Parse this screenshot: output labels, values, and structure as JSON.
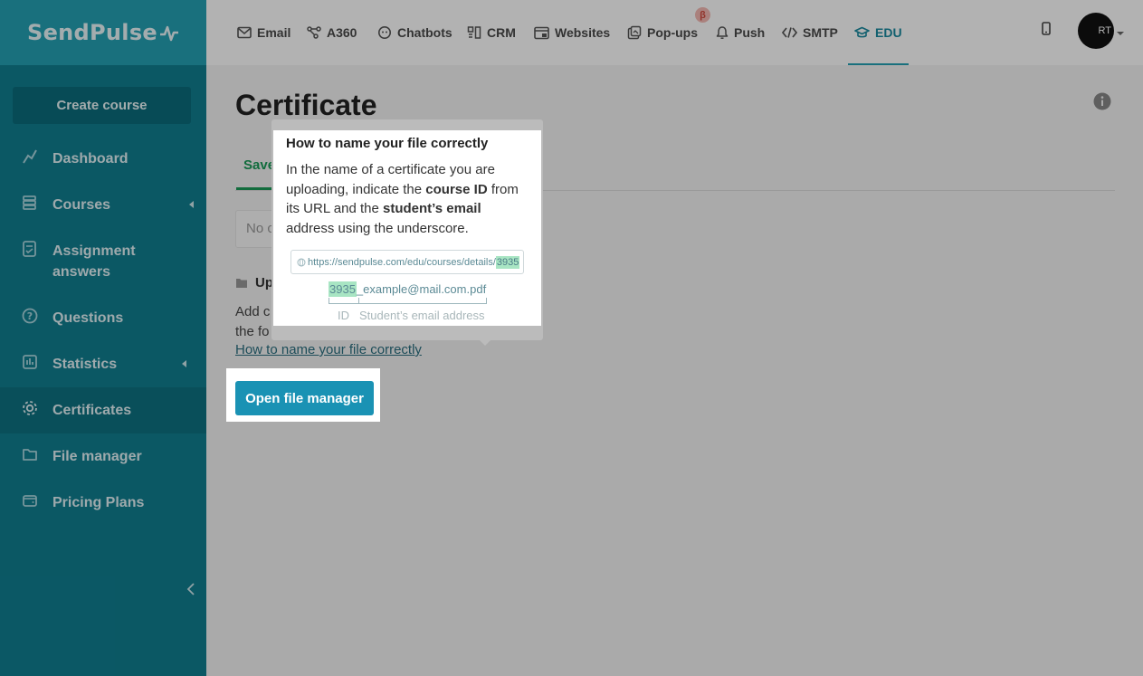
{
  "brand": {
    "logo_text": "SendPulse"
  },
  "sidebar": {
    "create_label": "Create course",
    "items": [
      {
        "label": "Dashboard",
        "icon": "chart-line-icon"
      },
      {
        "label": "Courses",
        "icon": "stack-icon",
        "has_submenu": true
      },
      {
        "label": "Assignment answers",
        "icon": "checklist-icon"
      },
      {
        "label": "Questions",
        "icon": "question-circle-icon"
      },
      {
        "label": "Statistics",
        "icon": "stats-icon",
        "has_submenu": true
      },
      {
        "label": "Certificates",
        "icon": "gear-badge-icon",
        "active": true
      },
      {
        "label": "File manager",
        "icon": "folder-icon"
      },
      {
        "label": "Pricing Plans",
        "icon": "wallet-icon"
      }
    ]
  },
  "topnav": {
    "items": [
      {
        "label": "Email",
        "icon": "envelope-icon"
      },
      {
        "label": "A360",
        "icon": "flow-icon"
      },
      {
        "label": "Chatbots",
        "icon": "chat-bubble-icon"
      },
      {
        "label": "CRM",
        "icon": "crm-icon"
      },
      {
        "label": "Websites",
        "icon": "website-icon"
      },
      {
        "label": "Pop-ups",
        "icon": "popup-icon"
      },
      {
        "label": "Push",
        "icon": "bell-icon"
      },
      {
        "label": "SMTP",
        "icon": "code-icon"
      },
      {
        "label": "EDU",
        "icon": "graduation-cap-icon",
        "active": true
      }
    ],
    "beta_badge": "β",
    "avatar_text": "RT"
  },
  "main": {
    "title": "Certificate",
    "tab_saved": "Save",
    "empty_text": "No c",
    "upload_title": "Up",
    "upload_text_1": "Add c",
    "upload_text_2": "the fo",
    "howto_link": "How to name your file correctly",
    "open_file_manager": "Open file manager"
  },
  "popover": {
    "title": "How to name your file correctly",
    "body_1": "In the name of a certificate you are uploading, indicate the ",
    "body_bold_1": "course ID",
    "body_2": " from its URL and the ",
    "body_bold_2": "student’s email",
    "body_3": " address using the underscore.",
    "url_prefix": "https://sendpulse.com/edu/courses/details/",
    "url_id": "3935",
    "file_id": "3935",
    "file_rest": "_example@mail.com.pdf",
    "caption_id": "ID",
    "caption_email": "Student’s email address"
  },
  "colors": {
    "sidebar_bg": "#107e90",
    "logo_bg": "#24a1b4",
    "accent": "#1a92b4",
    "saved_tab": "#1a9b58",
    "highlight_green": "#a8e5c3"
  }
}
